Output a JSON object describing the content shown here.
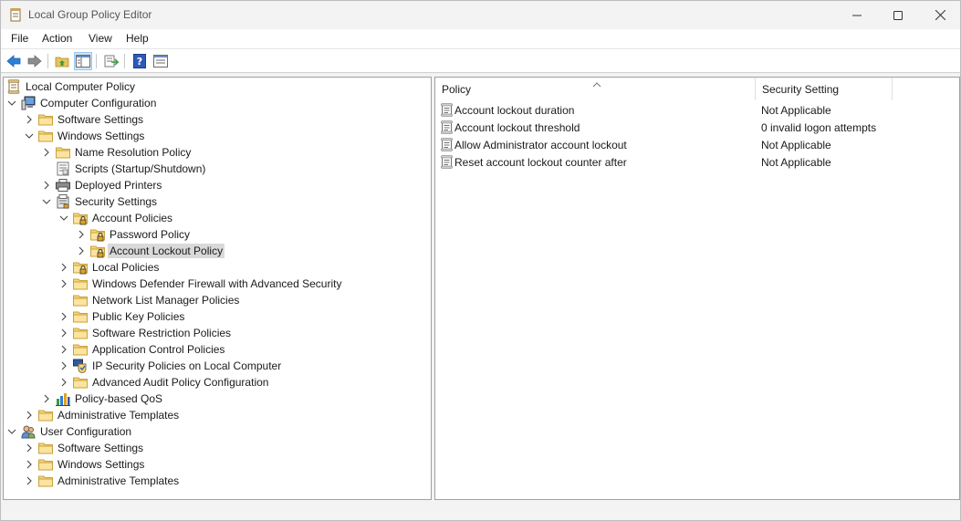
{
  "window": {
    "title": "Local Group Policy Editor"
  },
  "menu": [
    "File",
    "Action",
    "View",
    "Help"
  ],
  "toolbar": [
    "back-icon",
    "forward-icon",
    "up-folder-icon",
    "show-hide-tree-icon",
    "export-list-icon",
    "help-icon",
    "properties-icon"
  ],
  "tree": [
    {
      "label": "Local Computer Policy",
      "level": 0,
      "chev": "none",
      "icon": "policy-scroll"
    },
    {
      "label": "Computer Configuration",
      "level": 0,
      "chev": "down",
      "icon": "computer"
    },
    {
      "label": "Software Settings",
      "level": 1,
      "chev": "right",
      "icon": "folder"
    },
    {
      "label": "Windows Settings",
      "level": 1,
      "chev": "down",
      "icon": "folder"
    },
    {
      "label": "Name Resolution Policy",
      "level": 2,
      "chev": "right",
      "icon": "folder"
    },
    {
      "label": "Scripts (Startup/Shutdown)",
      "level": 2,
      "chev": "none",
      "icon": "script"
    },
    {
      "label": "Deployed Printers",
      "level": 2,
      "chev": "right",
      "icon": "printer"
    },
    {
      "label": "Security Settings",
      "level": 2,
      "chev": "down",
      "icon": "security"
    },
    {
      "label": "Account Policies",
      "level": 3,
      "chev": "down",
      "icon": "lock-folder"
    },
    {
      "label": "Password Policy",
      "level": 4,
      "chev": "right",
      "icon": "lock-folder"
    },
    {
      "label": "Account Lockout Policy",
      "level": 4,
      "chev": "right",
      "icon": "lock-folder",
      "selected": true
    },
    {
      "label": "Local Policies",
      "level": 3,
      "chev": "right",
      "icon": "lock-folder"
    },
    {
      "label": "Windows Defender Firewall with Advanced Security",
      "level": 3,
      "chev": "right",
      "icon": "folder"
    },
    {
      "label": "Network List Manager Policies",
      "level": 3,
      "chev": "none",
      "icon": "folder"
    },
    {
      "label": "Public Key Policies",
      "level": 3,
      "chev": "right",
      "icon": "folder"
    },
    {
      "label": "Software Restriction Policies",
      "level": 3,
      "chev": "right",
      "icon": "folder"
    },
    {
      "label": "Application Control Policies",
      "level": 3,
      "chev": "right",
      "icon": "folder"
    },
    {
      "label": "IP Security Policies on Local Computer",
      "level": 3,
      "chev": "right",
      "icon": "ipsec"
    },
    {
      "label": "Advanced Audit Policy Configuration",
      "level": 3,
      "chev": "right",
      "icon": "folder"
    },
    {
      "label": "Policy-based QoS",
      "level": 2,
      "chev": "right",
      "icon": "qos"
    },
    {
      "label": "Administrative Templates",
      "level": 1,
      "chev": "right",
      "icon": "folder"
    },
    {
      "label": "User Configuration",
      "level": 0,
      "chev": "down",
      "icon": "user"
    },
    {
      "label": "Software Settings",
      "level": 1,
      "chev": "right",
      "icon": "folder"
    },
    {
      "label": "Windows Settings",
      "level": 1,
      "chev": "right",
      "icon": "folder"
    },
    {
      "label": "Administrative Templates",
      "level": 1,
      "chev": "right",
      "icon": "folder"
    }
  ],
  "list": {
    "headers": {
      "policy": "Policy",
      "setting": "Security Setting"
    },
    "rows": [
      {
        "policy": "Account lockout duration",
        "setting": "Not Applicable"
      },
      {
        "policy": "Account lockout threshold",
        "setting": "0 invalid logon attempts"
      },
      {
        "policy": "Allow Administrator account lockout",
        "setting": "Not Applicable"
      },
      {
        "policy": "Reset account lockout counter after",
        "setting": "Not Applicable"
      }
    ]
  }
}
